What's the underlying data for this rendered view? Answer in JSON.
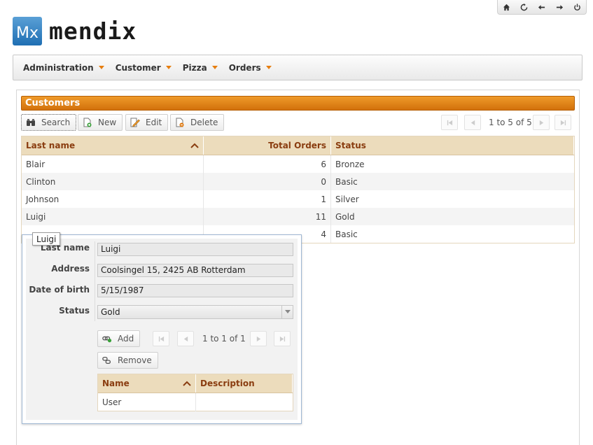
{
  "system": {
    "icons": [
      "home-icon",
      "refresh-icon",
      "back-icon",
      "forward-icon",
      "power-icon"
    ]
  },
  "logo": {
    "text": "mendix",
    "mark": "Mx"
  },
  "menu": [
    {
      "label": "Administration"
    },
    {
      "label": "Customer"
    },
    {
      "label": "Pizza"
    },
    {
      "label": "Orders"
    }
  ],
  "customers": {
    "title": "Customers",
    "buttons": {
      "search": "Search",
      "new": "New",
      "edit": "Edit",
      "delete": "Delete"
    },
    "paging": "1 to 5 of 5",
    "columns": {
      "last_name": "Last name",
      "total_orders": "Total Orders",
      "status": "Status"
    },
    "rows": [
      {
        "last_name": "Blair",
        "total_orders": "6",
        "status": "Bronze"
      },
      {
        "last_name": "Clinton",
        "total_orders": "0",
        "status": "Basic"
      },
      {
        "last_name": "Johnson",
        "total_orders": "1",
        "status": "Silver"
      },
      {
        "last_name": "Luigi",
        "total_orders": "11",
        "status": "Gold"
      },
      {
        "last_name": "",
        "total_orders": "4",
        "status": "Basic"
      }
    ]
  },
  "tooltip": "Luigi",
  "form": {
    "labels": {
      "last_name": "Last name",
      "address": "Address",
      "dob": "Date of birth",
      "status": "Status"
    },
    "values": {
      "last_name": "Luigi",
      "address": "Coolsingel 15, 2425 AB Rotterdam",
      "dob": "5/15/1987",
      "status": "Gold"
    },
    "add": "Add",
    "remove": "Remove",
    "paging": "1 to 1 of 1",
    "columns": {
      "name": "Name",
      "description": "Description"
    },
    "rows": [
      {
        "name": "User",
        "description": ""
      }
    ]
  },
  "colors": {
    "accent": "#e07d10",
    "header_bg": "#ecdcbc",
    "header_text": "#8a3d10"
  }
}
